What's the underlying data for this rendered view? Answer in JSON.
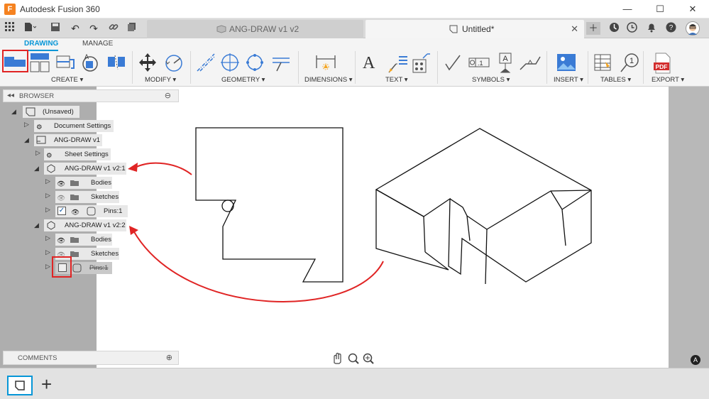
{
  "app": {
    "title": "Autodesk Fusion 360",
    "logo": "F"
  },
  "window_controls": {
    "minimize": "—",
    "maximize": "☐",
    "close": "✕"
  },
  "tabs": [
    {
      "label": "ANG-DRAW v1 v2",
      "state": "inactive"
    },
    {
      "label": "Untitled*",
      "state": "active",
      "close": "✕"
    }
  ],
  "ribbon": {
    "tabs": [
      {
        "label": "DRAWING",
        "active": true
      },
      {
        "label": "MANAGE",
        "active": false
      }
    ],
    "groups": {
      "create": "CREATE ▾",
      "modify": "MODIFY ▾",
      "geometry": "GEOMETRY ▾",
      "dimensions": "DIMENSIONS ▾",
      "text": "TEXT ▾",
      "symbols": "SYMBOLS ▾",
      "insert": "INSERT ▾",
      "tables": "TABLES ▾",
      "export": "EXPORT ▾"
    },
    "text_tool": "A",
    "pdf_label": "PDF",
    "balloon": "1"
  },
  "browser": {
    "title": "BROWSER",
    "rows": [
      {
        "label": "(Unsaved)"
      },
      {
        "label": "Document Settings"
      },
      {
        "label": "ANG-DRAW v1"
      },
      {
        "label": "Sheet Settings"
      },
      {
        "label": "ANG-DRAW v1 v2:1"
      },
      {
        "label": "Bodies"
      },
      {
        "label": "Sketches"
      },
      {
        "label": "Pins:1"
      },
      {
        "label": "ANG-DRAW v1 v2:2"
      },
      {
        "label": "Bodies"
      },
      {
        "label": "Sketches"
      },
      {
        "label": "Pins:1"
      }
    ]
  },
  "comments": {
    "title": "COMMENTS"
  },
  "colors": {
    "accent": "#0696d7",
    "highlight": "#e02424",
    "panel": "#aeaeae"
  }
}
